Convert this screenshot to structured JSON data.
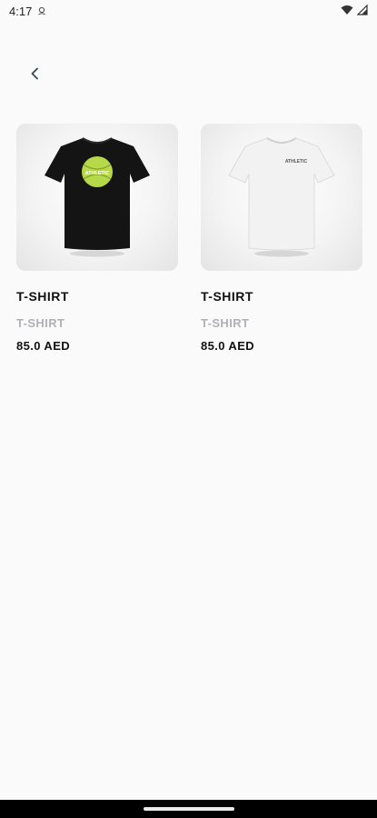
{
  "status_bar": {
    "time": "4:17",
    "icons": [
      "notification-icon",
      "wifi-icon",
      "signal-icon"
    ]
  },
  "header": {
    "back_icon": "chevron-left-icon"
  },
  "products": [
    {
      "title": "T-SHIRT",
      "subtitle": "T-SHIRT",
      "price": "85.0 AED",
      "image": "black-tshirt-image",
      "logo_text": "ATHLETIC",
      "shirt_color": "#141414",
      "logo_color": "#b6d94a"
    },
    {
      "title": "T-SHIRT",
      "subtitle": "T-SHIRT",
      "price": "85.0 AED",
      "image": "white-tshirt-image",
      "logo_text": "ATHLETIC",
      "shirt_color": "#f2f2f2",
      "logo_color": "#555555"
    }
  ],
  "colors": {
    "background": "#fafafa",
    "subtitle": "#b0b0b6",
    "text": "#111111"
  }
}
